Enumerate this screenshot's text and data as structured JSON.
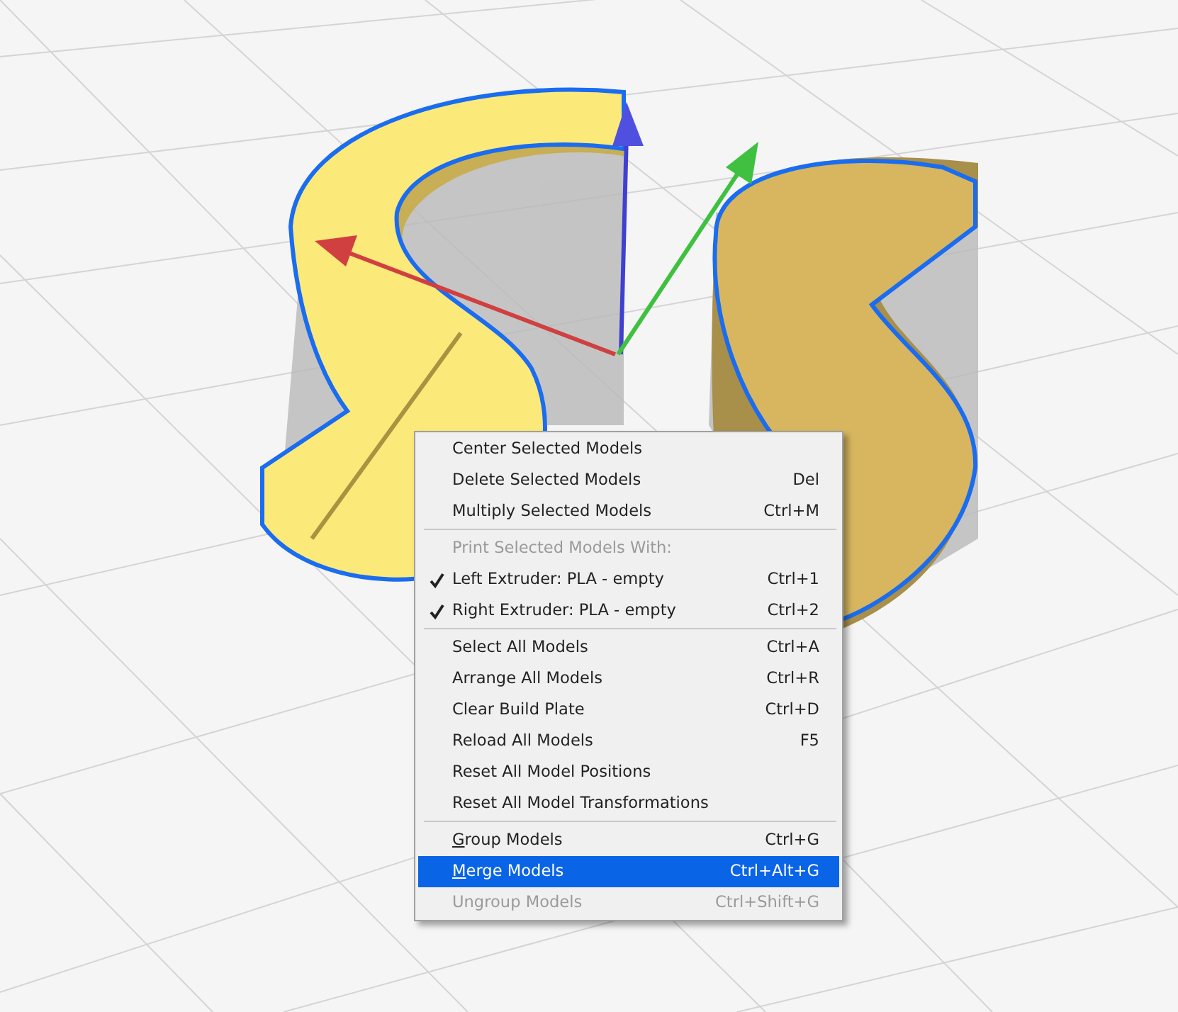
{
  "context_menu": {
    "items": [
      {
        "kind": "item",
        "label": "Center Selected Models",
        "disabled": false,
        "selected": false,
        "first_letter_underlined": false
      },
      {
        "kind": "item",
        "label": "Delete Selected Models",
        "shortcut": "Del",
        "disabled": false,
        "selected": false,
        "first_letter_underlined": false
      },
      {
        "kind": "item",
        "label": "Multiply Selected Models",
        "shortcut": "Ctrl+M",
        "disabled": false,
        "selected": false,
        "first_letter_underlined": false
      },
      {
        "kind": "separator"
      },
      {
        "kind": "header",
        "label": "Print Selected Models With:"
      },
      {
        "kind": "check",
        "label": "Left Extruder: PLA - empty",
        "shortcut": "Ctrl+1",
        "checked": true,
        "disabled": false,
        "selected": false,
        "first_letter_underlined": false
      },
      {
        "kind": "check",
        "label": "Right Extruder: PLA - empty",
        "shortcut": "Ctrl+2",
        "checked": true,
        "disabled": false,
        "selected": false,
        "first_letter_underlined": false
      },
      {
        "kind": "separator"
      },
      {
        "kind": "item",
        "label": "Select All Models",
        "shortcut": "Ctrl+A",
        "disabled": false,
        "selected": false,
        "first_letter_underlined": false
      },
      {
        "kind": "item",
        "label": "Arrange All Models",
        "shortcut": "Ctrl+R",
        "disabled": false,
        "selected": false,
        "first_letter_underlined": false
      },
      {
        "kind": "item",
        "label": "Clear Build Plate",
        "shortcut": "Ctrl+D",
        "disabled": false,
        "selected": false,
        "first_letter_underlined": false
      },
      {
        "kind": "item",
        "label": "Reload All Models",
        "shortcut": "F5",
        "disabled": false,
        "selected": false,
        "first_letter_underlined": false
      },
      {
        "kind": "item",
        "label": "Reset All Model Positions",
        "disabled": false,
        "selected": false,
        "first_letter_underlined": false
      },
      {
        "kind": "item",
        "label": "Reset All Model Transformations",
        "disabled": false,
        "selected": false,
        "first_letter_underlined": false
      },
      {
        "kind": "separator"
      },
      {
        "kind": "item",
        "label": "Group Models",
        "shortcut": "Ctrl+G",
        "disabled": false,
        "selected": false,
        "first_letter_underlined": true
      },
      {
        "kind": "item",
        "label": "Merge Models",
        "shortcut": "Ctrl+Alt+G",
        "disabled": false,
        "selected": true,
        "first_letter_underlined": true
      },
      {
        "kind": "item",
        "label": "Ungroup Models",
        "shortcut": "Ctrl+Shift+G",
        "disabled": true,
        "selected": false,
        "first_letter_underlined": false
      }
    ]
  }
}
